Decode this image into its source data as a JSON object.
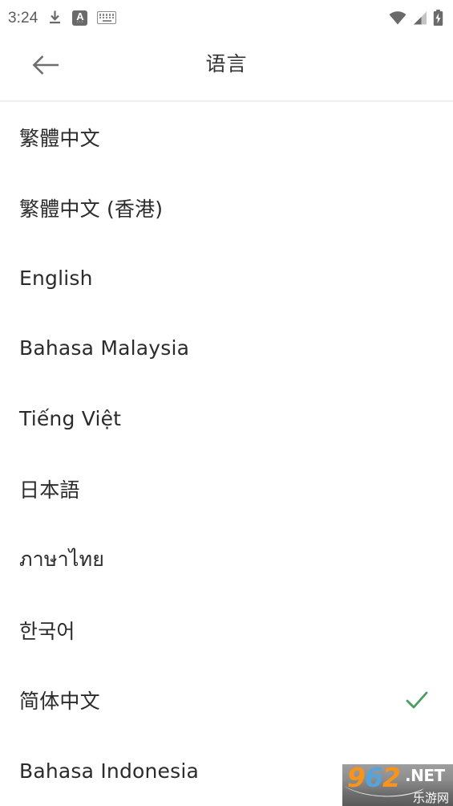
{
  "status_bar": {
    "time": "3:24",
    "left_icons": [
      "download-icon",
      "ime-a-icon",
      "keyboard-icon"
    ],
    "right_icons": [
      "wifi-icon",
      "cellular-signal-icon",
      "battery-charging-icon"
    ],
    "ime_letter": "A",
    "ime_dots": "···",
    "icon_color": "#6a6a6a",
    "time_color": "#5c5c5c"
  },
  "app_bar": {
    "back_icon": "arrow-left-icon",
    "title": "语言"
  },
  "list": {
    "selected_index": 8,
    "check_color": "#4a9d60",
    "items": [
      {
        "label": "繁體中文",
        "selected": false
      },
      {
        "label": "繁體中文 (香港)",
        "selected": false
      },
      {
        "label": "English",
        "selected": false
      },
      {
        "label": "Bahasa Malaysia",
        "selected": false
      },
      {
        "label": "Tiếng Việt",
        "selected": false
      },
      {
        "label": "日本語",
        "selected": false
      },
      {
        "label": "ภาษาไทย",
        "selected": false
      },
      {
        "label": "한국어",
        "selected": false
      },
      {
        "label": "简体中文",
        "selected": true
      },
      {
        "label": "Bahasa Indonesia",
        "selected": false
      }
    ]
  },
  "watermark": {
    "digit_9": "9",
    "digit_6": "6",
    "digit_2": "2",
    "tld": ".NET",
    "cn_text": "乐游网",
    "orange": "#F7941E",
    "blue": "#55A5DC"
  }
}
